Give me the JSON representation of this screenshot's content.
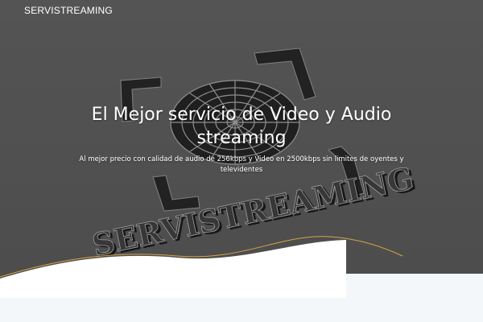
{
  "header": {
    "brand": "SERVISTREAMING"
  },
  "hero": {
    "title": "El Mejor servicio de Video y Audio streaming",
    "subtitle": "Al mejor precio con calidad de audio de 256kbps y Video en 2500kbps sin limites de oyentes y televidentes",
    "background_logo_text": "SERVISTREAMING"
  },
  "colors": {
    "hero_background": "#5b5b5b",
    "text": "#ffffff",
    "wave_line": "#d9a441",
    "page_background": "#f4f7fa"
  }
}
